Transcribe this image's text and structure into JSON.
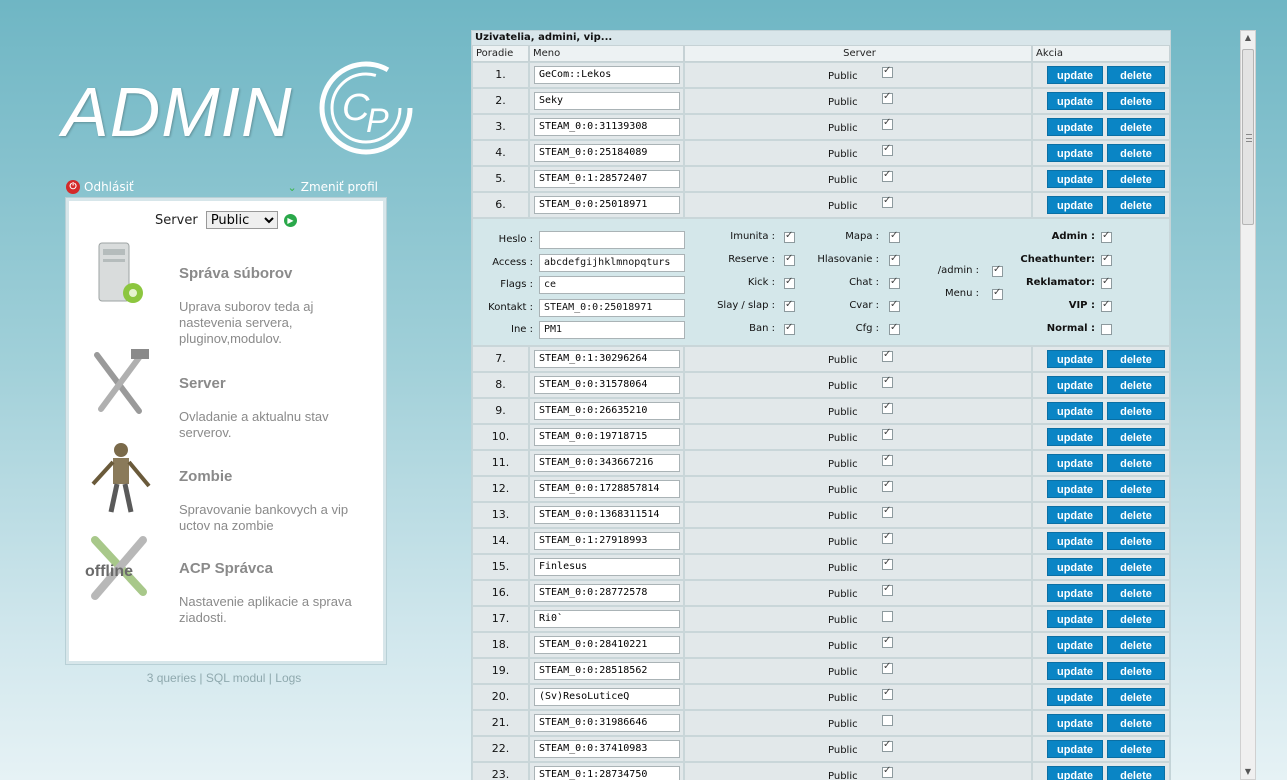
{
  "logo": {
    "text": "ADMIN",
    "cp": "CP"
  },
  "userbar": {
    "logout": "Odhlásiť",
    "profile": "Zmeniť profil"
  },
  "server_selector": {
    "label": "Server",
    "selected": "Public",
    "options": [
      "Public"
    ]
  },
  "menu": [
    {
      "title": "Správa súborov",
      "desc": "Uprava suborov teda aj nastevenia servera, pluginov,modulov.",
      "icon": "file-server-icon"
    },
    {
      "title": "Server",
      "desc": "Ovladanie a aktualnu stav serverov.",
      "icon": "tools-icon"
    },
    {
      "title": "Zombie",
      "desc": "Spravovanie bankovych a vip uctov na zombie",
      "icon": "zombie-icon"
    },
    {
      "title": "ACP Správca",
      "desc": "Nastavenie aplikacie a sprava ziadosti.",
      "icon": "offline-wrench-icon"
    }
  ],
  "footer": {
    "queries": "3 queries",
    "sql": "SQL modul",
    "logs": "Logs",
    "sep": " | "
  },
  "table": {
    "title": "Uzivatelia, admini, vip...",
    "headers": {
      "order": "Poradie",
      "name": "Meno",
      "server": "Server",
      "action": "Akcia"
    },
    "server_label": "Public",
    "update_label": "update",
    "delete_label": "delete",
    "rows_top": [
      {
        "ord": "1.",
        "name": "GeCom::Lekos",
        "checked": true
      },
      {
        "ord": "2.",
        "name": "Seky",
        "checked": true
      },
      {
        "ord": "3.",
        "name": "STEAM_0:0:31139308",
        "checked": true
      },
      {
        "ord": "4.",
        "name": "STEAM_0:0:25184089",
        "checked": true
      },
      {
        "ord": "5.",
        "name": "STEAM_0:1:28572407",
        "checked": true
      },
      {
        "ord": "6.",
        "name": "STEAM_0:0:25018971",
        "checked": true
      }
    ],
    "detail": {
      "fields": [
        {
          "label": "Heslo :",
          "value": ""
        },
        {
          "label": "Access :",
          "value": "abcdefgijhklmnopqturs"
        },
        {
          "label": "Flags :",
          "value": "ce"
        },
        {
          "label": "Kontakt :",
          "value": "STEAM_0:0:25018971"
        },
        {
          "label": "Ine :",
          "value": "PM1"
        }
      ],
      "col1": [
        {
          "label": "Imunita :",
          "checked": true
        },
        {
          "label": "Reserve :",
          "checked": true
        },
        {
          "label": "Kick :",
          "checked": true
        },
        {
          "label": "Slay / slap :",
          "checked": true
        },
        {
          "label": "Ban :",
          "checked": true
        }
      ],
      "col2": [
        {
          "label": "Mapa :",
          "checked": true
        },
        {
          "label": "Hlasovanie :",
          "checked": true
        },
        {
          "label": "Chat :",
          "checked": true
        },
        {
          "label": "Cvar :",
          "checked": true
        },
        {
          "label": "Cfg :",
          "checked": true
        }
      ],
      "col3": [
        {
          "label": "/admin :",
          "checked": true
        },
        {
          "label": "Menu :",
          "checked": true
        }
      ],
      "col4": [
        {
          "label": "Admin :",
          "checked": true
        },
        {
          "label": "Cheathunter:",
          "checked": true
        },
        {
          "label": "Reklamator:",
          "checked": true
        },
        {
          "label": "VIP :",
          "checked": true
        },
        {
          "label": "Normal :",
          "checked": false
        }
      ]
    },
    "rows_bottom": [
      {
        "ord": "7.",
        "name": "STEAM_0:1:30296264",
        "checked": true
      },
      {
        "ord": "8.",
        "name": "STEAM_0:0:31578064",
        "checked": true
      },
      {
        "ord": "9.",
        "name": "STEAM_0:0:26635210",
        "checked": true
      },
      {
        "ord": "10.",
        "name": "STEAM_0:0:19718715",
        "checked": true
      },
      {
        "ord": "11.",
        "name": "STEAM_0:0:343667216",
        "checked": true
      },
      {
        "ord": "12.",
        "name": "STEAM_0:0:1728857814",
        "checked": true
      },
      {
        "ord": "13.",
        "name": "STEAM_0:0:1368311514",
        "checked": true
      },
      {
        "ord": "14.",
        "name": "STEAM_0:1:27918993",
        "checked": true
      },
      {
        "ord": "15.",
        "name": "Finlesus",
        "checked": true
      },
      {
        "ord": "16.",
        "name": "STEAM_0:0:28772578",
        "checked": true
      },
      {
        "ord": "17.",
        "name": "Ri0`",
        "checked": false
      },
      {
        "ord": "18.",
        "name": "STEAM_0:0:28410221",
        "checked": true
      },
      {
        "ord": "19.",
        "name": "STEAM_0:0:28518562",
        "checked": true
      },
      {
        "ord": "20.",
        "name": "(Sv)ResoLuticeQ",
        "checked": true
      },
      {
        "ord": "21.",
        "name": "STEAM_0:0:31986646",
        "checked": false
      },
      {
        "ord": "22.",
        "name": "STEAM_0:0:37410983",
        "checked": true
      },
      {
        "ord": "23.",
        "name": "STEAM_0:1:28734750",
        "checked": true
      }
    ]
  }
}
